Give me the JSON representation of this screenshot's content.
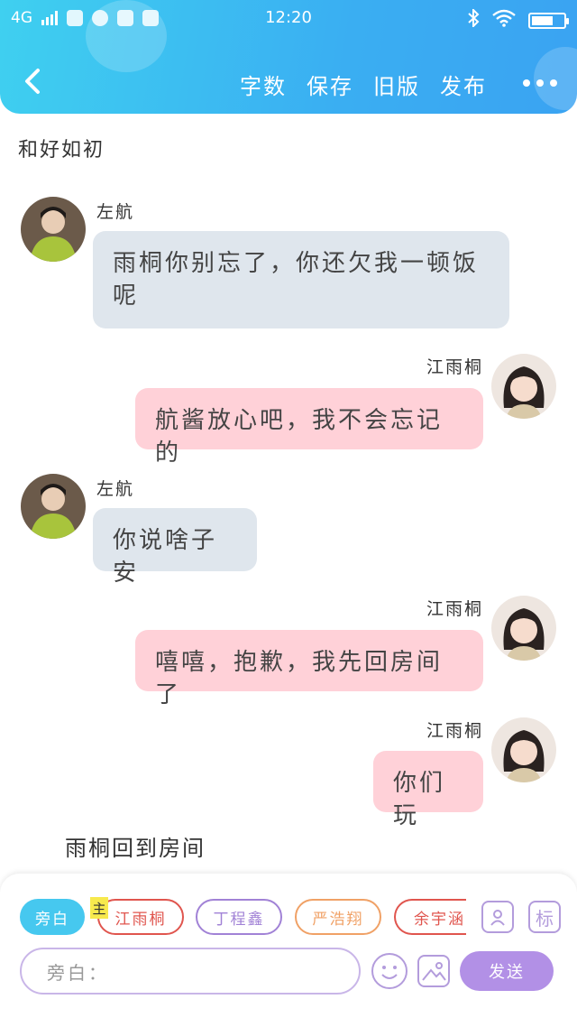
{
  "status_bar": {
    "network": "4G",
    "time": "12:20"
  },
  "nav": {
    "actions": [
      "字数",
      "保存",
      "旧版",
      "发布"
    ]
  },
  "story_title": "和好如初",
  "messages": [
    {
      "side": "left",
      "name": "左航",
      "text": "雨桐你别忘了，你还欠我一顿饭呢"
    },
    {
      "side": "right",
      "name": "江雨桐",
      "text": "航酱放心吧，我不会忘记的"
    },
    {
      "side": "left",
      "name": "左航",
      "text": "你说啥子安"
    },
    {
      "side": "right",
      "name": "江雨桐",
      "text": "嘻嘻，抱歉，我先回房间了"
    },
    {
      "side": "right",
      "name": "江雨桐",
      "text": "你们玩"
    }
  ],
  "narration": "雨桐回到房间",
  "characters": {
    "main_tag": "主",
    "chips": [
      {
        "label": "旁白",
        "color": "#46c8ef"
      },
      {
        "label": "江雨桐",
        "color": "#e0554e"
      },
      {
        "label": "丁程鑫",
        "color": "#a182d6"
      },
      {
        "label": "严浩翔",
        "color": "#f0a166"
      },
      {
        "label": "余宇涵",
        "color": "#e0554e"
      }
    ]
  },
  "tools": {
    "mark_label": "标"
  },
  "composer": {
    "placeholder": "旁白：",
    "send_label": "发送"
  },
  "colors": {
    "header_gradient_start": "#3fd0f0",
    "header_gradient_end": "#3aa3f2",
    "left_bubble": "#dfe6ed",
    "right_bubble": "#ffd1d8",
    "accent_purple": "#b290e6"
  }
}
